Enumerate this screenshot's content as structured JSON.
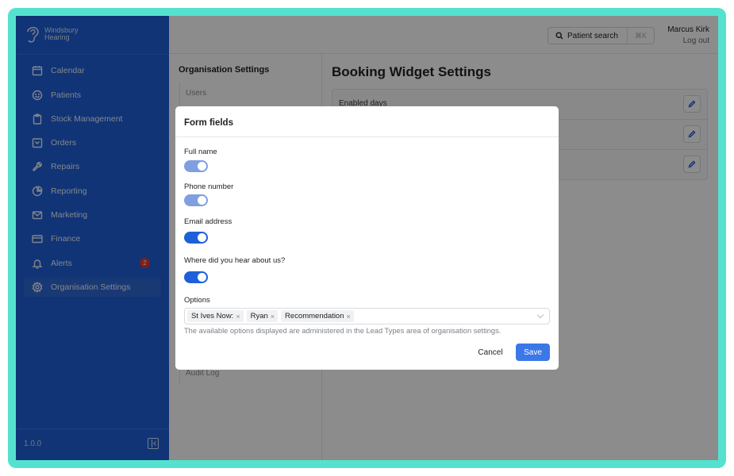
{
  "brand": {
    "line1": "Windsbury",
    "line2": "Hearing",
    "icon": "ear-logo"
  },
  "sidebar": {
    "items": [
      {
        "label": "Calendar",
        "icon": "calendar-icon"
      },
      {
        "label": "Patients",
        "icon": "smiley-icon"
      },
      {
        "label": "Stock Management",
        "icon": "clipboard-icon"
      },
      {
        "label": "Orders",
        "icon": "inbox-icon"
      },
      {
        "label": "Repairs",
        "icon": "wrench-icon"
      },
      {
        "label": "Reporting",
        "icon": "pie-chart-icon"
      },
      {
        "label": "Marketing",
        "icon": "mail-icon"
      },
      {
        "label": "Finance",
        "icon": "card-icon"
      },
      {
        "label": "Alerts",
        "icon": "bell-icon",
        "badge": "2"
      },
      {
        "label": "Organisation Settings",
        "icon": "gear-icon",
        "active": true
      }
    ],
    "version": "1.0.0"
  },
  "topbar": {
    "search_label": "Patient search",
    "shortcut": "⌘K",
    "user_name": "Marcus Kirk",
    "logout_label": "Log out"
  },
  "settings_nav": {
    "title": "Organisation Settings",
    "items": [
      "Users",
      "Audit Log"
    ]
  },
  "main": {
    "title": "Booking Widget Settings",
    "rows": [
      {
        "label": "Enabled days"
      }
    ]
  },
  "modal": {
    "title": "Form fields",
    "fields": [
      {
        "label": "Full name",
        "enabled": true,
        "locked": true
      },
      {
        "label": "Phone number",
        "enabled": true,
        "locked": true
      },
      {
        "label": "Email address",
        "enabled": true,
        "locked": false
      },
      {
        "label": "Where did you hear about us?",
        "enabled": true,
        "locked": false
      }
    ],
    "options_label": "Options",
    "options": [
      "St Ives Now:",
      "Ryan",
      "Recommendation"
    ],
    "help_text": "The available options displayed are administered in the Lead Types area of organisation settings.",
    "cancel_label": "Cancel",
    "save_label": "Save"
  },
  "colors": {
    "frame": "#54e2cf",
    "sidebar": "#1e60d8",
    "accent": "#3b78e7",
    "badge": "#d93a35"
  }
}
